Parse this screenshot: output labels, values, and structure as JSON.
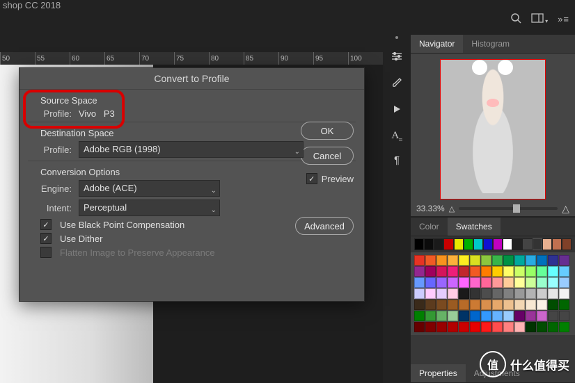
{
  "app_title": "shop CC 2018",
  "top_icons": {
    "search": "search-icon",
    "layout": "layout-icon",
    "menu": "menu-icon"
  },
  "ruler": {
    "ticks": [
      "50",
      "55",
      "60",
      "65",
      "70",
      "75",
      "80",
      "85",
      "90",
      "95",
      "100"
    ]
  },
  "vtoolbar": [
    "sliders-icon",
    "brush-icon",
    "play-icon",
    "text-icon",
    "paragraph-icon"
  ],
  "modal": {
    "title": "Convert to Profile",
    "source_space_label": "Source Space",
    "source_profile_label": "Profile:",
    "source_profile_value": "Vivo   P3",
    "dest_space_label": "Destination Space",
    "dest_profile_label": "Profile:",
    "dest_profile_value": "Adobe RGB (1998)",
    "conversion_options_label": "Conversion Options",
    "engine_label": "Engine:",
    "engine_value": "Adobe (ACE)",
    "intent_label": "Intent:",
    "intent_value": "Perceptual",
    "blackpoint_label": "Use Black Point Compensation",
    "dither_label": "Use Dither",
    "flatten_label": "Flatten Image to Preserve Appearance",
    "ok": "OK",
    "cancel": "Cancel",
    "preview": "Preview",
    "advanced": "Advanced",
    "blackpoint_checked": true,
    "dither_checked": true,
    "preview_checked": true,
    "flatten_checked": false
  },
  "navigator": {
    "tabs": [
      "Navigator",
      "Histogram"
    ],
    "active": 0,
    "zoom": "33.33%"
  },
  "color_panel": {
    "tabs": [
      "Color",
      "Swatches"
    ],
    "active": 1
  },
  "swatch_strip": [
    "#000000",
    "#0b0b0b",
    "#1a1a1a",
    "#c80000",
    "#e8e800",
    "#00b000",
    "#00c8c8",
    "#1010d0",
    "#c000c0",
    "#ffffff",
    "#222222",
    "#444444",
    "",
    "#e8b090",
    "#c07050",
    "#804028"
  ],
  "swatch_grid_colors": [
    "#e73323",
    "#f15a24",
    "#f7931e",
    "#fbb03b",
    "#fcee21",
    "#d9e021",
    "#8cc63f",
    "#39b54a",
    "#009245",
    "#00a99d",
    "#29abe2",
    "#0071bc",
    "#2e3192",
    "#662d91",
    "#93278f",
    "#9e005d",
    "#d4145a",
    "#ed1e79",
    "#c1272d",
    "#f15a24",
    "#ff7c00",
    "#ffcc00",
    "#ffff66",
    "#ccff66",
    "#99ff66",
    "#66ff99",
    "#66ffff",
    "#66ccff",
    "#6699ff",
    "#6666ff",
    "#9966ff",
    "#cc66ff",
    "#ff66ff",
    "#ff66cc",
    "#ff6699",
    "#ff9999",
    "#ffcc99",
    "#ffff99",
    "#ccff99",
    "#99ffcc",
    "#99ffff",
    "#99ccff",
    "#ccccff",
    "#ffccff",
    "#e5ccff",
    "#ffcce5",
    "#1a1a1a",
    "#333333",
    "#4d4d4d",
    "#666666",
    "#808080",
    "#999999",
    "#b3b3b3",
    "#cccccc",
    "#e6e6e6",
    "#f2f2f2",
    "#3a2a1a",
    "#5c3b1e",
    "#7a4a20",
    "#9a5b22",
    "#b86b28",
    "#cc7a33",
    "#d98f4d",
    "#e6a86b",
    "#edc08f",
    "#f2d6b3",
    "#f7e7d2",
    "#fbf1e6",
    "#004d00",
    "#006600",
    "#008000",
    "#339933",
    "#66b266",
    "#99cc99",
    "#003366",
    "#0066cc",
    "#3399ff",
    "#66b2ff",
    "#99ccff",
    "#660066",
    "#993399",
    "#cc66cc",
    "",
    "",
    "#660000",
    "#800000",
    "#990000",
    "#b30000",
    "#cc0000",
    "#e60000",
    "#ff1a1a",
    "#ff4d4d",
    "#ff8080",
    "#ffb3b3",
    "#003300",
    "#004d00",
    "#006600",
    "#008000"
  ],
  "bottom_panel": {
    "tabs": [
      "Properties",
      "Adjustments"
    ],
    "active": 0
  },
  "watermark": "什么值得买",
  "watermark_badge": "值"
}
